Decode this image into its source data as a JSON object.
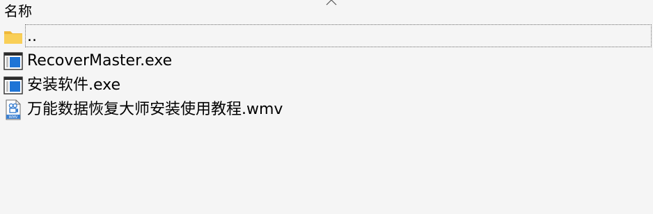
{
  "header": {
    "name_column": "名称"
  },
  "files": [
    {
      "name": "..",
      "icon": "folder-icon",
      "selected": true
    },
    {
      "name": "RecoverMaster.exe",
      "icon": "exe-icon"
    },
    {
      "name": "安装软件.exe",
      "icon": "exe-icon"
    },
    {
      "name": "万能数据恢复大师安装使用教程.wmv",
      "icon": "wmv-video-icon"
    }
  ],
  "colors": {
    "background": "#f5f5f5",
    "folder": "#f7c84a",
    "exe_blue": "#1e74d6",
    "wmv_blue": "#3a7fd0"
  }
}
